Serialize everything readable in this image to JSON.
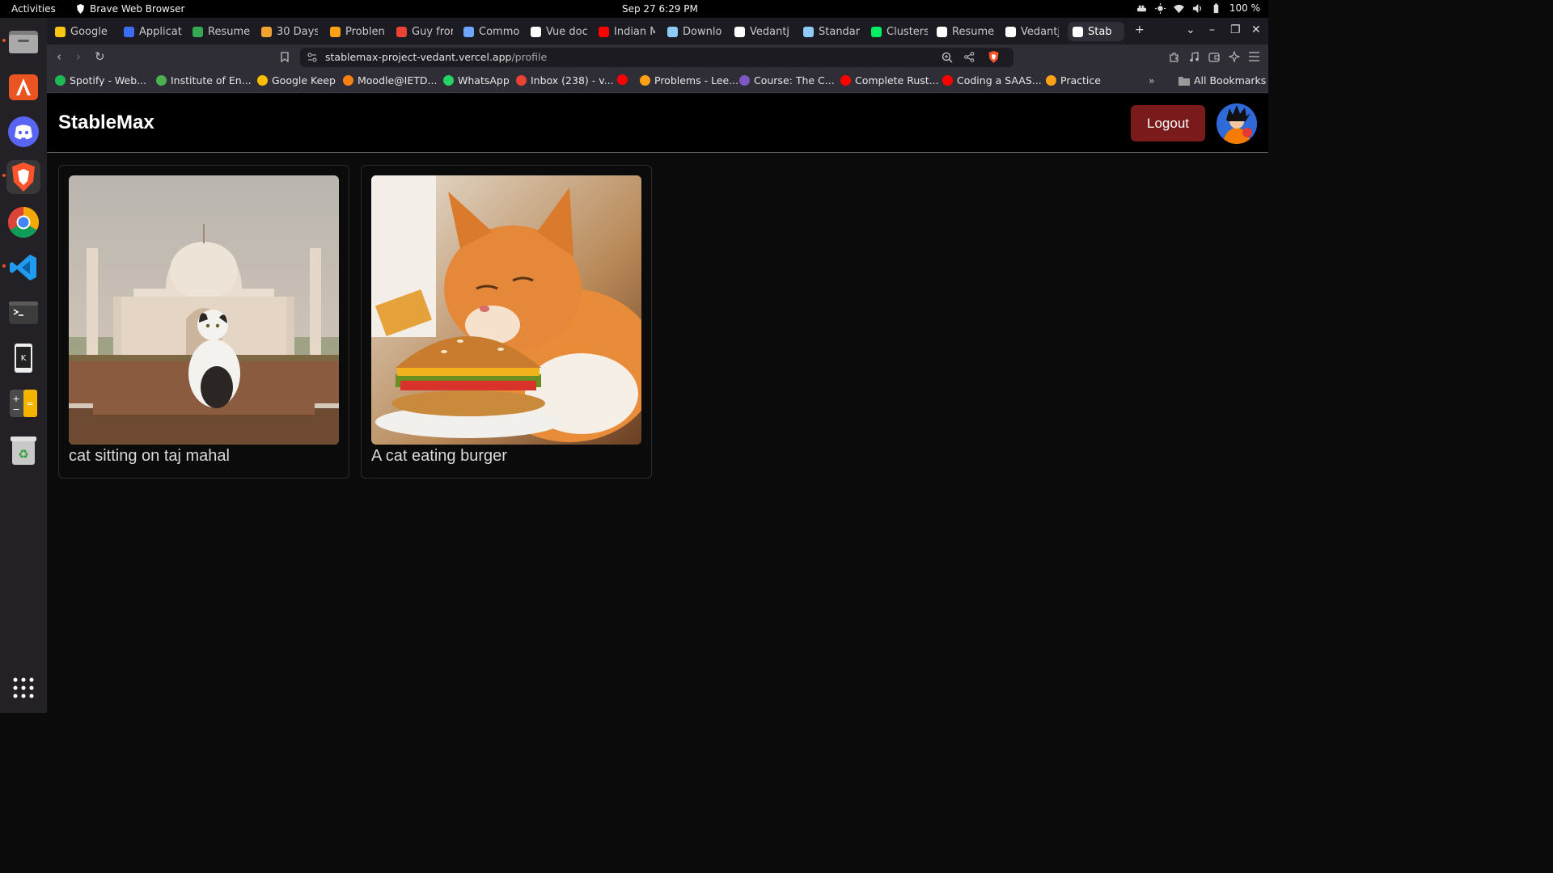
{
  "system": {
    "activities": "Activities",
    "app_name": "Brave Web Browser",
    "clock": "Sep 27   6:29 PM",
    "battery": "100 %"
  },
  "dock": {
    "items": [
      "files",
      "app-center",
      "discord",
      "brave",
      "chrome",
      "vscode",
      "terminal",
      "kdeconnect",
      "calculator",
      "trash",
      "show-apps"
    ]
  },
  "tabs": [
    {
      "label": "Google",
      "color": "#f9c513"
    },
    {
      "label": "Applicat",
      "color": "#3b6ef5"
    },
    {
      "label": "Resume",
      "color": "#34a853"
    },
    {
      "label": "30 Days",
      "color": "#f0a22e"
    },
    {
      "label": "Problen",
      "color": "#ffa116"
    },
    {
      "label": "Guy fror",
      "color": "#ea4335"
    },
    {
      "label": "Commo",
      "color": "#6ea7ff"
    },
    {
      "label": "Vue doc",
      "color": "#ffffff"
    },
    {
      "label": "Indian M",
      "color": "#ff0000"
    },
    {
      "label": "Downlo",
      "color": "#8ecbf5"
    },
    {
      "label": "Vedantj",
      "color": "#ffffff"
    },
    {
      "label": "Standar",
      "color": "#8ecbf5"
    },
    {
      "label": "Clusters",
      "color": "#00ed64"
    },
    {
      "label": "Resume",
      "color": "#ffffff"
    },
    {
      "label": "Vedantj",
      "color": "#ffffff"
    },
    {
      "label": "Stab",
      "color": "#ffffff"
    }
  ],
  "address": {
    "host": "stablemax-project-vedant.vercel.app",
    "path": "/profile"
  },
  "bookmarks": [
    {
      "label": "Spotify - Web...",
      "color": "#1db954"
    },
    {
      "label": "Institute of En...",
      "color": "#4caf50"
    },
    {
      "label": "Google Keep",
      "color": "#fbbc04"
    },
    {
      "label": "Moodle@IETD...",
      "color": "#f98012"
    },
    {
      "label": "WhatsApp",
      "color": "#25d366"
    },
    {
      "label": "Inbox (238) - v...",
      "color": "#ea4335"
    },
    {
      "label": "",
      "color": "#ff0000"
    },
    {
      "label": "Problems - Lee...",
      "color": "#ffa116"
    },
    {
      "label": "Course: The C...",
      "color": "#7e57c2"
    },
    {
      "label": "Complete Rust...",
      "color": "#ff0000"
    },
    {
      "label": "Coding a SAAS...",
      "color": "#ff0000"
    },
    {
      "label": "Practice",
      "color": "#ffa116"
    }
  ],
  "all_bookmarks": "All Bookmarks",
  "app": {
    "brand": "StableMax",
    "logout_label": "Logout",
    "accent": "#7b1a1a"
  },
  "gallery": [
    {
      "caption": "cat sitting on taj mahal"
    },
    {
      "caption": "A cat eating burger"
    }
  ]
}
